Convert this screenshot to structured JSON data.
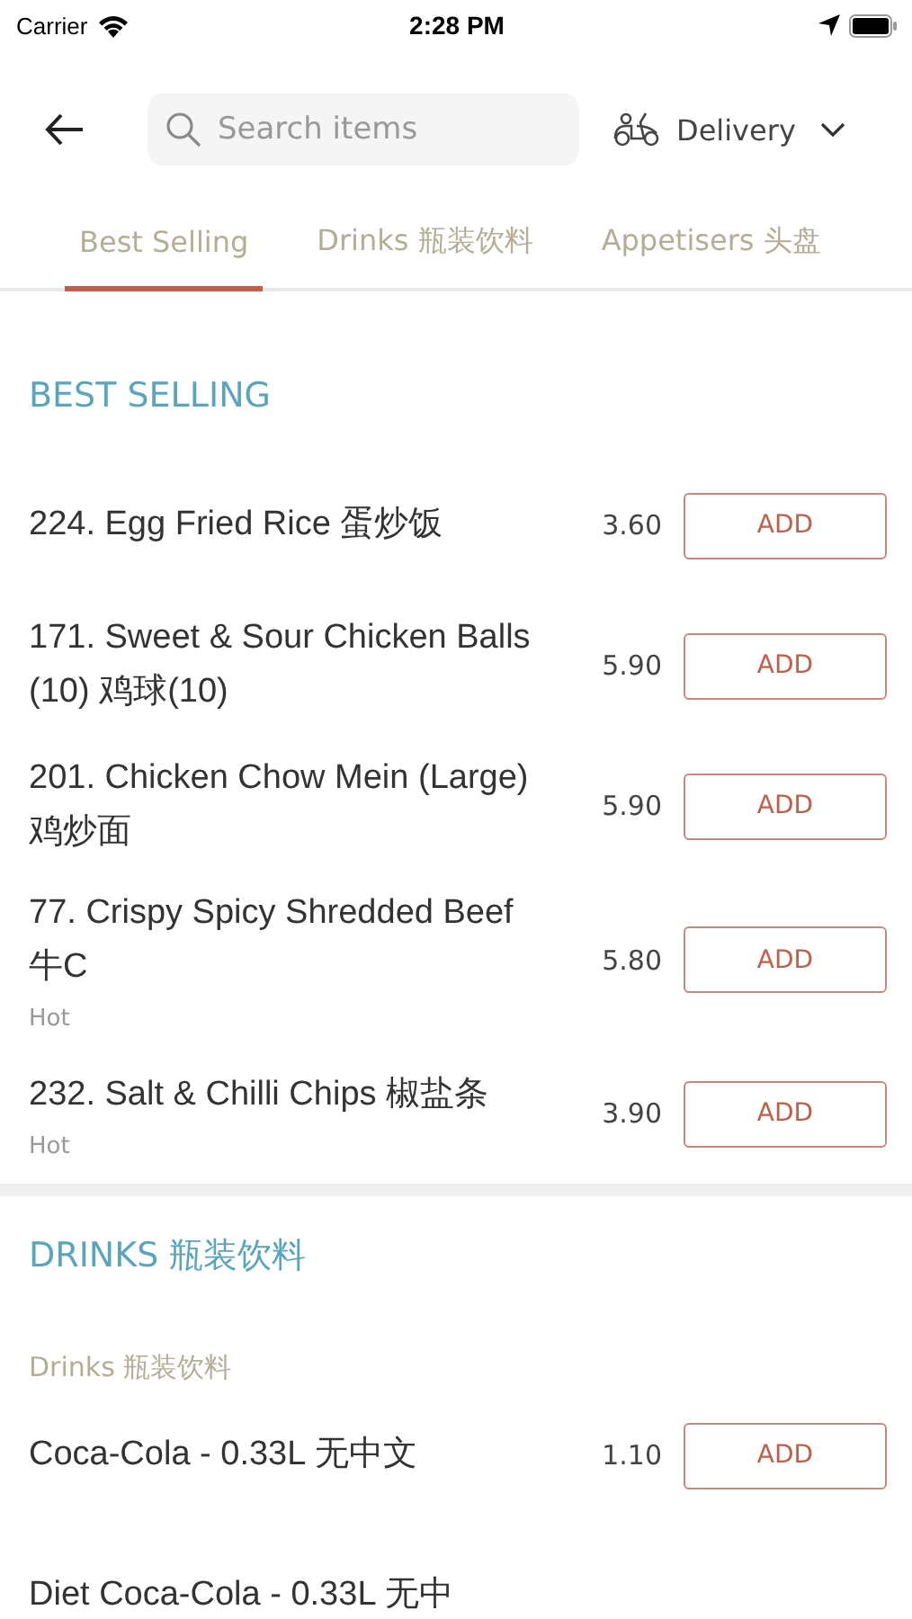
{
  "status_bar": {
    "carrier": "Carrier",
    "time": "2:28 PM"
  },
  "header": {
    "search": {
      "placeholder": "Search items"
    },
    "mode": "Delivery"
  },
  "tabs": [
    {
      "label": "Best Selling",
      "selected": true
    },
    {
      "label": "Drinks 瓶装饮料",
      "selected": false
    },
    {
      "label": "Appetisers 头盘",
      "selected": false
    }
  ],
  "sections": [
    {
      "title": "BEST SELLING",
      "items": [
        {
          "name": "224. Egg Fried Rice 蛋炒饭",
          "price": "3.60",
          "button": "ADD"
        },
        {
          "name": "171. Sweet & Sour Chicken Balls (10) 鸡球(10)",
          "price": "5.90",
          "button": "ADD"
        },
        {
          "name": "201. Chicken Chow Mein (Large) 鸡炒面",
          "price": "5.90",
          "button": "ADD"
        },
        {
          "name": "77. Crispy Spicy Shredded Beef 牛C",
          "note": "Hot",
          "price": "5.80",
          "button": "ADD"
        },
        {
          "name": "232. Salt & Chilli Chips 椒盐条",
          "note": "Hot",
          "price": "3.90",
          "button": "ADD"
        }
      ]
    },
    {
      "title": "DRINKS 瓶装饮料",
      "subtitle": "Drinks 瓶装饮料",
      "items": [
        {
          "name": "Coca-Cola - 0.33L 无中文",
          "price": "1.10",
          "button": "ADD"
        },
        {
          "name": "Diet Coca-Cola - 0.33L 无中"
        }
      ]
    }
  ]
}
